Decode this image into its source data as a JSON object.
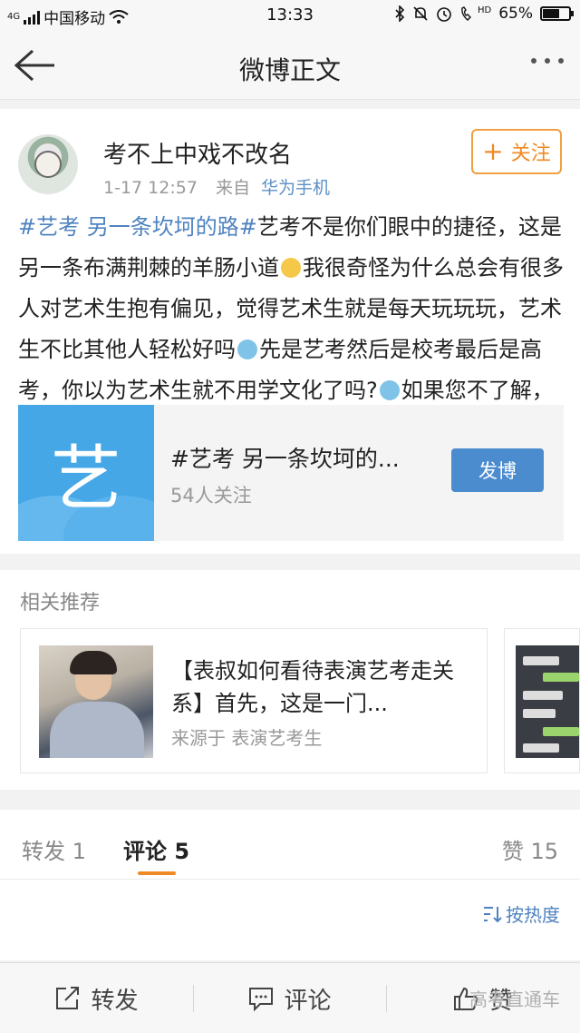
{
  "status_bar": {
    "network": "4G",
    "carrier": "中国移动",
    "time": "13:33",
    "hd": "HD",
    "battery": "65%",
    "battery_level": 0.65
  },
  "nav": {
    "title": "微博正文"
  },
  "post": {
    "user_name": "考不上中戏不改名",
    "timestamp": "1-17 12:57",
    "source_prefix": "来自",
    "source": "华为手机",
    "follow_label": "关注",
    "topic_tag": "#艺考 另一条坎坷的路#",
    "text_1": "艺考不是你们眼中的捷径，这是另一条布满荆棘的羊肠小道",
    "text_2": "我很奇怪为什么总会有很多人对艺术生抱有偏见，觉得艺术生就是每天玩玩玩，艺术生不比其他人轻松好吗",
    "text_3": "先是艺考然后是校考最后是高考，你以为艺术生就不用学文化了吗?",
    "text_4": "如果您不了解，那请您不要妄加评论"
  },
  "topic_card": {
    "image_char": "艺",
    "title": "#艺考 另一条坎坷的...",
    "followers": "54人关注",
    "button": "发博"
  },
  "related": {
    "title": "相关推荐",
    "card": {
      "text": "【表叔如何看待表演艺考走关系】首先，这是一门...",
      "source": "来源于 表演艺考生"
    }
  },
  "tabs": {
    "repost": "转发 1",
    "comment": "评论 5",
    "like": "赞 15",
    "sort": "按热度"
  },
  "bottom_bar": {
    "repost": "转发",
    "comment": "评论",
    "like": "赞",
    "watermark": "高考直通车"
  },
  "colors": {
    "accent_orange": "#f08a24",
    "link_blue": "#4f83c0",
    "button_blue": "#4b8ccf"
  }
}
